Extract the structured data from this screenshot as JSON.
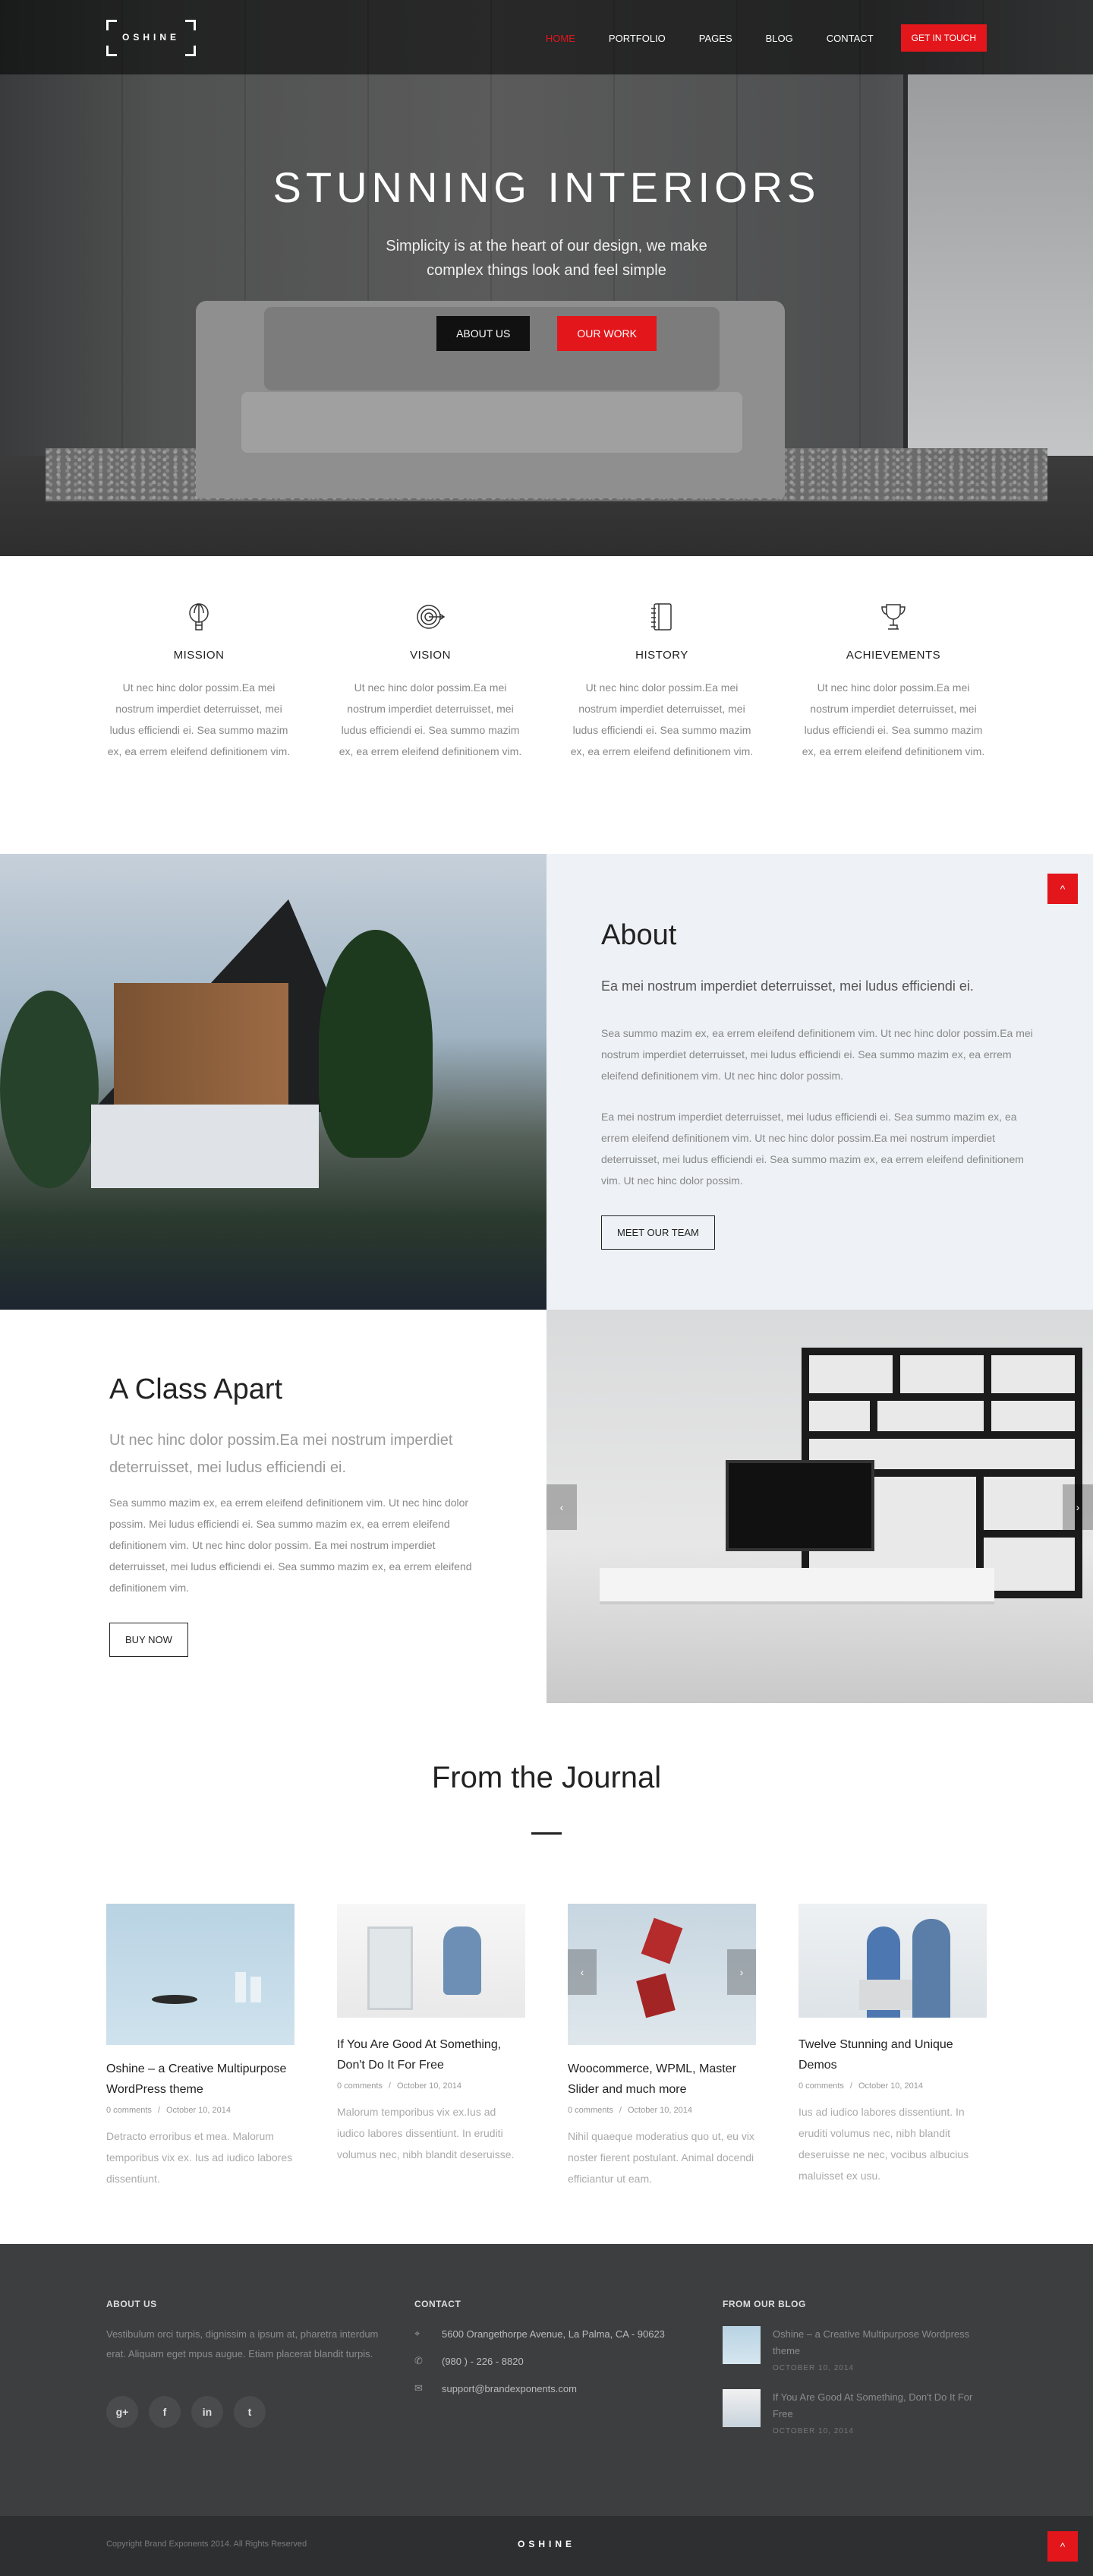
{
  "header": {
    "logo": "OSHINE",
    "nav": [
      "HOME",
      "PORTFOLIO",
      "PAGES",
      "BLOG",
      "CONTACT"
    ],
    "cta": "GET IN TOUCH",
    "active_color": "#e3161b"
  },
  "hero": {
    "title": "STUNNING INTERIORS",
    "subtitle": "Simplicity is at the heart of our design, we make complex things look and feel simple",
    "button_primary": "ABOUT US",
    "button_secondary": "OUR WORK"
  },
  "features": [
    {
      "icon": "balloon-icon",
      "title": "MISSION",
      "text": "Ut nec hinc dolor possim.Ea mei nostrum imperdiet deterruisset, mei ludus efficiendi ei. Sea summo mazim ex, ea errem eleifend definitionem vim."
    },
    {
      "icon": "target-icon",
      "title": "VISION",
      "text": "Ut nec hinc dolor possim.Ea mei nostrum imperdiet deterruisset, mei ludus efficiendi ei. Sea summo mazim ex, ea errem eleifend definitionem vim."
    },
    {
      "icon": "notebook-icon",
      "title": "HISTORY",
      "text": "Ut nec hinc dolor possim.Ea mei nostrum imperdiet deterruisset, mei ludus efficiendi ei. Sea summo mazim ex, ea errem eleifend definitionem vim."
    },
    {
      "icon": "trophy-icon",
      "title": "ACHIEVEMENTS",
      "text": "Ut nec hinc dolor possim.Ea mei nostrum imperdiet deterruisset, mei ludus efficiendi ei. Sea summo mazim ex, ea errem eleifend definitionem vim."
    }
  ],
  "about": {
    "title": "About",
    "lead": "Ea mei nostrum imperdiet deterruisset, mei ludus efficiendi ei.",
    "p1": "Sea summo mazim ex, ea errem eleifend definitionem vim. Ut nec hinc dolor possim.Ea mei nostrum imperdiet deterruisset, mei ludus efficiendi ei. Sea summo mazim ex, ea errem eleifend definitionem vim. Ut nec hinc dolor possim.",
    "p2": "Ea mei nostrum imperdiet deterruisset, mei ludus efficiendi ei. Sea summo mazim ex, ea errem eleifend definitionem vim. Ut nec hinc dolor possim.Ea mei nostrum imperdiet deterruisset, mei ludus efficiendi ei. Sea summo mazim ex, ea errem eleifend definitionem vim. Ut nec hinc dolor possim.",
    "button": "MEET OUR TEAM",
    "scroll_up": "^"
  },
  "class_apart": {
    "title": "A Class Apart",
    "lead": "Ut nec hinc dolor possim.Ea mei nostrum imperdiet deterruisset, mei ludus efficiendi ei.",
    "p1": "Sea summo mazim ex, ea errem eleifend definitionem vim. Ut nec hinc dolor possim. Mei ludus efficiendi ei. Sea summo mazim ex, ea errem eleifend definitionem vim. Ut nec hinc dolor possim. Ea mei nostrum imperdiet deterruisset, mei ludus efficiendi ei. Sea summo mazim ex, ea errem eleifend definitionem vim.",
    "button": "BUY NOW",
    "prev": "‹",
    "next": "›"
  },
  "journal": {
    "title": "From the Journal",
    "posts": [
      {
        "title": "Oshine – a Creative Multipurpose WordPress theme",
        "comments": "0 comments",
        "date": "October 10, 2014",
        "excerpt": "Detracto erroribus et mea. Malorum temporibus vix ex. Ius ad iudico labores dissentiunt."
      },
      {
        "title": "If You Are Good At Something, Don't Do It For Free",
        "comments": "0 comments",
        "date": "October 10, 2014",
        "excerpt": "Malorum temporibus vix ex.Ius ad iudico labores dissentiunt. In eruditi volumus nec, nibh blandit deseruisse."
      },
      {
        "title": "Woocommerce, WPML, Master Slider and much more",
        "comments": "0 comments",
        "date": "October 10, 2014",
        "excerpt": "Nihil quaeque moderatius quo ut, eu vix noster fierent postulant. Animal docendi efficiantur ut eam."
      },
      {
        "title": "Twelve Stunning and Unique Demos",
        "comments": "0 comments",
        "date": "October 10, 2014",
        "excerpt": "Ius ad iudico labores dissentiunt. In eruditi volumus nec, nibh blandit deseruisse ne nec, vocibus albucius maluisset ex usu."
      }
    ],
    "separator": "/",
    "prev": "‹",
    "next": "›"
  },
  "footer": {
    "about_title": "ABOUT US",
    "about_text": "Vestibulum orci turpis, dignissim a ipsum at, pharetra interdum erat. Aliquam eget mpus augue. Etiam placerat blandit turpis.",
    "socials": [
      "g+",
      "f",
      "in",
      "t"
    ],
    "contact_title": "CONTACT",
    "address": "5600 Orangethorpe Avenue, La Palma, CA - 90623",
    "phone": "(980 ) - 226 - 8820",
    "email": "support@brandexponents.com",
    "blog_title": "FROM OUR BLOG",
    "blog": [
      {
        "title": "Oshine – a Creative Multipurpose Wordpress theme",
        "date": "OCTOBER 10, 2014"
      },
      {
        "title": "If You Are Good At Something, Don't Do It For Free",
        "date": "OCTOBER 10, 2014"
      }
    ]
  },
  "bottom": {
    "copyright": "Copyright Brand Exponents 2014. All Rights Reserved",
    "logo": "OSHINE",
    "to_top": "^"
  }
}
